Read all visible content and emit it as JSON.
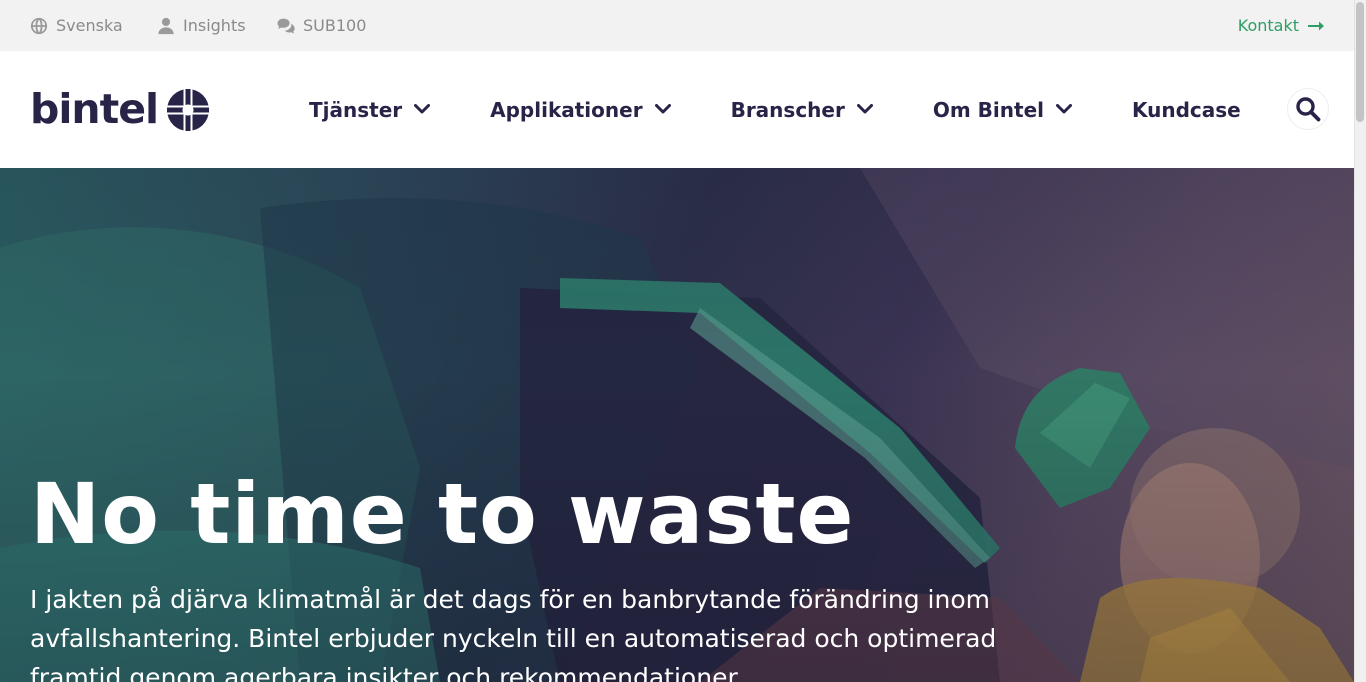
{
  "topbar": {
    "language": {
      "label": "Svenska",
      "icon": "globe-icon"
    },
    "insights": {
      "label": "Insights",
      "icon": "user-icon"
    },
    "sub100": {
      "label": "SUB100",
      "icon": "chat-icon"
    },
    "contact": {
      "label": "Kontakt",
      "icon": "arrow-right-icon"
    }
  },
  "header": {
    "logo_text": "bintel",
    "nav": [
      {
        "label": "Tjänster",
        "has_dropdown": true
      },
      {
        "label": "Applikationer",
        "has_dropdown": true
      },
      {
        "label": "Branscher",
        "has_dropdown": true
      },
      {
        "label": "Om Bintel",
        "has_dropdown": true
      },
      {
        "label": "Kundcase",
        "has_dropdown": false
      }
    ],
    "search_icon": "search-icon"
  },
  "hero": {
    "title": "No time to waste",
    "subtitle": "I jakten på djärva klimatmål är det dags för en banbrytande förändring inom avfallshantering. Bintel erbjuder nyckeln till en automatiserad och optimerad framtid genom agerbara insikter och rekommendationer."
  },
  "colors": {
    "brand_navy": "#272448",
    "accent_green": "#2e9e64",
    "topbar_bg": "#f2f2f2",
    "topbar_text": "#8a8a8a"
  }
}
